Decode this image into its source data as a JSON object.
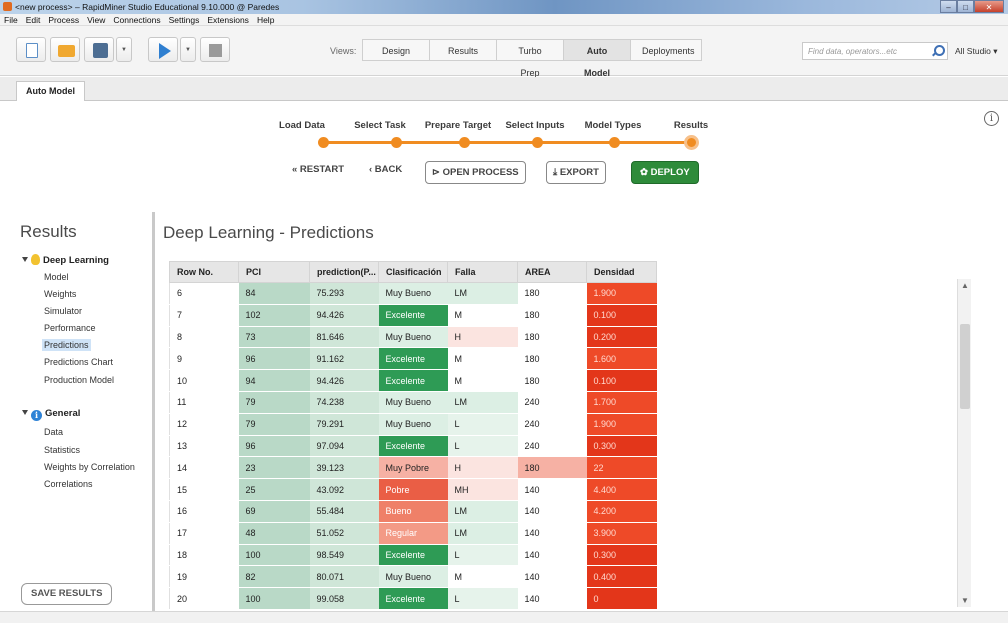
{
  "window": {
    "title": "<new process> – RapidMiner Studio Educational 9.10.000 @ Paredes"
  },
  "menu": [
    "File",
    "Edit",
    "Process",
    "View",
    "Connections",
    "Settings",
    "Extensions",
    "Help"
  ],
  "toolbar": {
    "views_label": "Views:",
    "views": [
      "Design",
      "Results",
      "Turbo Prep",
      "Auto Model",
      "Deployments"
    ],
    "active_view": "Auto Model",
    "search_placeholder": "Find data, operators...etc",
    "studio_label": "All Studio ▾"
  },
  "tab": {
    "label": "Auto Model"
  },
  "steps": [
    "Load Data",
    "Select Task",
    "Prepare Target",
    "Select Inputs",
    "Model Types",
    "Results"
  ],
  "actions": {
    "restart": "« RESTART",
    "back": "‹ BACK",
    "open_process": "⊳ OPEN PROCESS",
    "export": "⤓ EXPORT",
    "deploy": "DEPLOY"
  },
  "sidebar": {
    "title": "Results",
    "groups": [
      {
        "label": "Deep Learning",
        "items": [
          "Model",
          "Weights",
          "Simulator",
          "Performance",
          "Predictions",
          "Predictions Chart",
          "Production Model"
        ]
      },
      {
        "label": "General",
        "items": [
          "Data",
          "Statistics",
          "Weights by Correlation",
          "Correlations"
        ]
      }
    ],
    "active_item": "Predictions",
    "save_button": "SAVE RESULTS"
  },
  "main": {
    "title": "Deep Learning - Predictions",
    "table": {
      "columns": [
        "Row No.",
        "PCI",
        "prediction(P...",
        "Clasificación",
        "Falla",
        "AREA",
        "Densidad"
      ],
      "rows": [
        [
          "6",
          "84",
          "75.293",
          "Muy Bueno",
          "LM",
          "180",
          "1.900"
        ],
        [
          "7",
          "102",
          "94.426",
          "Excelente",
          "M",
          "180",
          "0.100"
        ],
        [
          "8",
          "73",
          "81.646",
          "Muy Bueno",
          "H",
          "180",
          "0.200"
        ],
        [
          "9",
          "96",
          "91.162",
          "Excelente",
          "M",
          "180",
          "1.600"
        ],
        [
          "10",
          "94",
          "94.426",
          "Excelente",
          "M",
          "180",
          "0.100"
        ],
        [
          "11",
          "79",
          "74.238",
          "Muy Bueno",
          "LM",
          "240",
          "1.700"
        ],
        [
          "12",
          "79",
          "79.291",
          "Muy Bueno",
          "L",
          "240",
          "1.900"
        ],
        [
          "13",
          "96",
          "97.094",
          "Excelente",
          "L",
          "240",
          "0.300"
        ],
        [
          "14",
          "23",
          "39.123",
          "Muy Pobre",
          "H",
          "180",
          "22"
        ],
        [
          "15",
          "25",
          "43.092",
          "Pobre",
          "MH",
          "140",
          "4.400"
        ],
        [
          "16",
          "69",
          "55.484",
          "Bueno",
          "LM",
          "140",
          "4.200"
        ],
        [
          "17",
          "48",
          "51.052",
          "Regular",
          "LM",
          "140",
          "3.900"
        ],
        [
          "18",
          "100",
          "98.549",
          "Excelente",
          "L",
          "140",
          "0.300"
        ],
        [
          "19",
          "82",
          "80.071",
          "Muy Bueno",
          "M",
          "140",
          "0.400"
        ],
        [
          "20",
          "100",
          "99.058",
          "Excelente",
          "L",
          "140",
          "0"
        ]
      ],
      "colors": {
        "pci": "#b9d9c7",
        "prediction": "#cfe6d8",
        "clasificacion": {
          "Excelente": "#2e9b55",
          "Muy Bueno": "#dcefe4",
          "Muy Pobre": "#f6b1a4",
          "Pobre": "#ea5e45",
          "Bueno": "#ef8068",
          "Regular": "#f39a86"
        },
        "falla": {
          "LM": "#dcefe4",
          "L": "#e6f3eb",
          "M": "#ffffff",
          "H": "#fbe4e0",
          "MH": "#fbe4e0"
        },
        "area_highlight": "#f6b1a4",
        "densidad_low": "#e3361a",
        "densidad_high": "#ee4a28"
      }
    }
  }
}
